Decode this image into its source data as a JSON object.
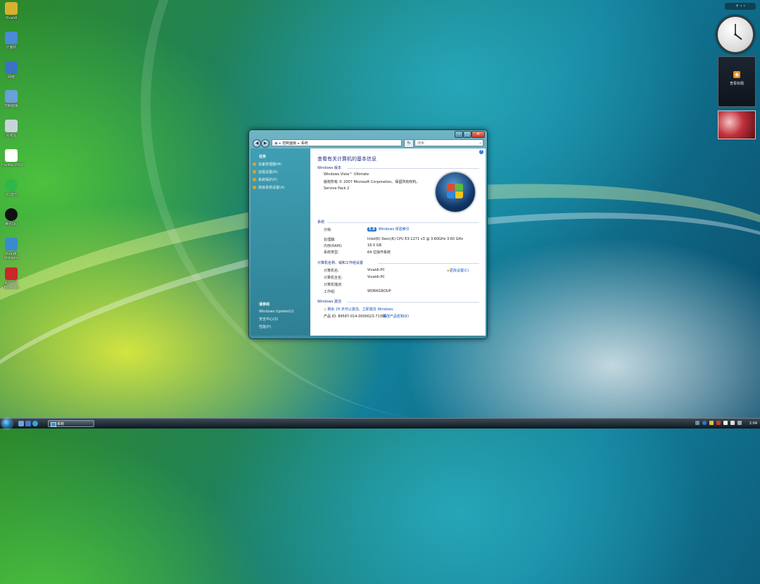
{
  "desktop": {
    "icons": [
      {
        "label": "Vivaldi",
        "color": "#d8b030"
      },
      {
        "label": "计算机",
        "color": "#4a8ad6"
      },
      {
        "label": "网络",
        "color": "#3b72c4"
      },
      {
        "label": "控制面板",
        "color": "#6aa0d8"
      },
      {
        "label": "回收站",
        "color": "#c8d4dc"
      },
      {
        "label": "FoxMail2000",
        "color": "#ffffff"
      },
      {
        "label": "QQ音乐",
        "color": "#2eb84a"
      },
      {
        "label": "腾讯QQ",
        "color": "#111111"
      },
      {
        "label": "Vivaldi-Vistapro",
        "color": "#3a8ad0"
      },
      {
        "label": "AIDA64 Extreme",
        "color": "#c8282a"
      }
    ]
  },
  "sidebar": {
    "controls": "+ ‹ ›",
    "rss_label": "查看标题"
  },
  "window": {
    "title_buttons": {
      "minimize": "–",
      "maximize": "▢",
      "close": "✕"
    },
    "nav": {
      "back": "◀",
      "forward": "▶",
      "breadcrumb": [
        "控制面板",
        "系统"
      ],
      "refresh": "↻",
      "search_placeholder": "搜索"
    },
    "tasks": {
      "header": "任务",
      "items": [
        "设备管理器(M)",
        "远程设置(R)",
        "系统保护(P)",
        "高级系统设置(A)"
      ],
      "see_also_header": "请参阅",
      "see_also": [
        "Windows Update(U)",
        "安全中心(S)",
        "性能(P)"
      ]
    },
    "content": {
      "help": "?",
      "title": "查看有关计算机的基本信息",
      "edition_section": "Windows 版本",
      "edition": "Windows Vista™ Ultimate",
      "copyright": "版权所有 © 2007 Microsoft Corporation。保留所有权利。",
      "service_pack": "Service Pack 2",
      "system_section": "系统",
      "rating_label": "分级:",
      "rating_score": "5.9",
      "rating_link": "Windows 体验索引",
      "processor_label": "处理器:",
      "processor_value": "Intel(R) Xeon(R) CPU E3-1271 v3 @ 3.60GHz   3.60 GHz",
      "memory_label": "内存(RAM):",
      "memory_value": "16.0 GB",
      "type_label": "系统类型:",
      "type_value": "64 位操作系统",
      "name_section": "计算机名称、域和工作组设置",
      "computer_name_label": "计算机名:",
      "computer_name_value": "Vivaldi-PC",
      "full_name_label": "计算机全名:",
      "full_name_value": "Vivaldi-PC",
      "description_label": "计算机描述:",
      "workgroup_label": "工作组:",
      "workgroup_value": "WORKGROUP",
      "change_settings": "更改设置(C)",
      "activation_section": "Windows 激活",
      "activation_text": "剩余 29 天可以激活。立即激活 Windows",
      "product_id_label": "产品 ID: 89587-014-0000023-71366",
      "change_key": "更改产品密钥(K)"
    }
  },
  "taskbar": {
    "window_button": "系统",
    "time": "2:04"
  }
}
